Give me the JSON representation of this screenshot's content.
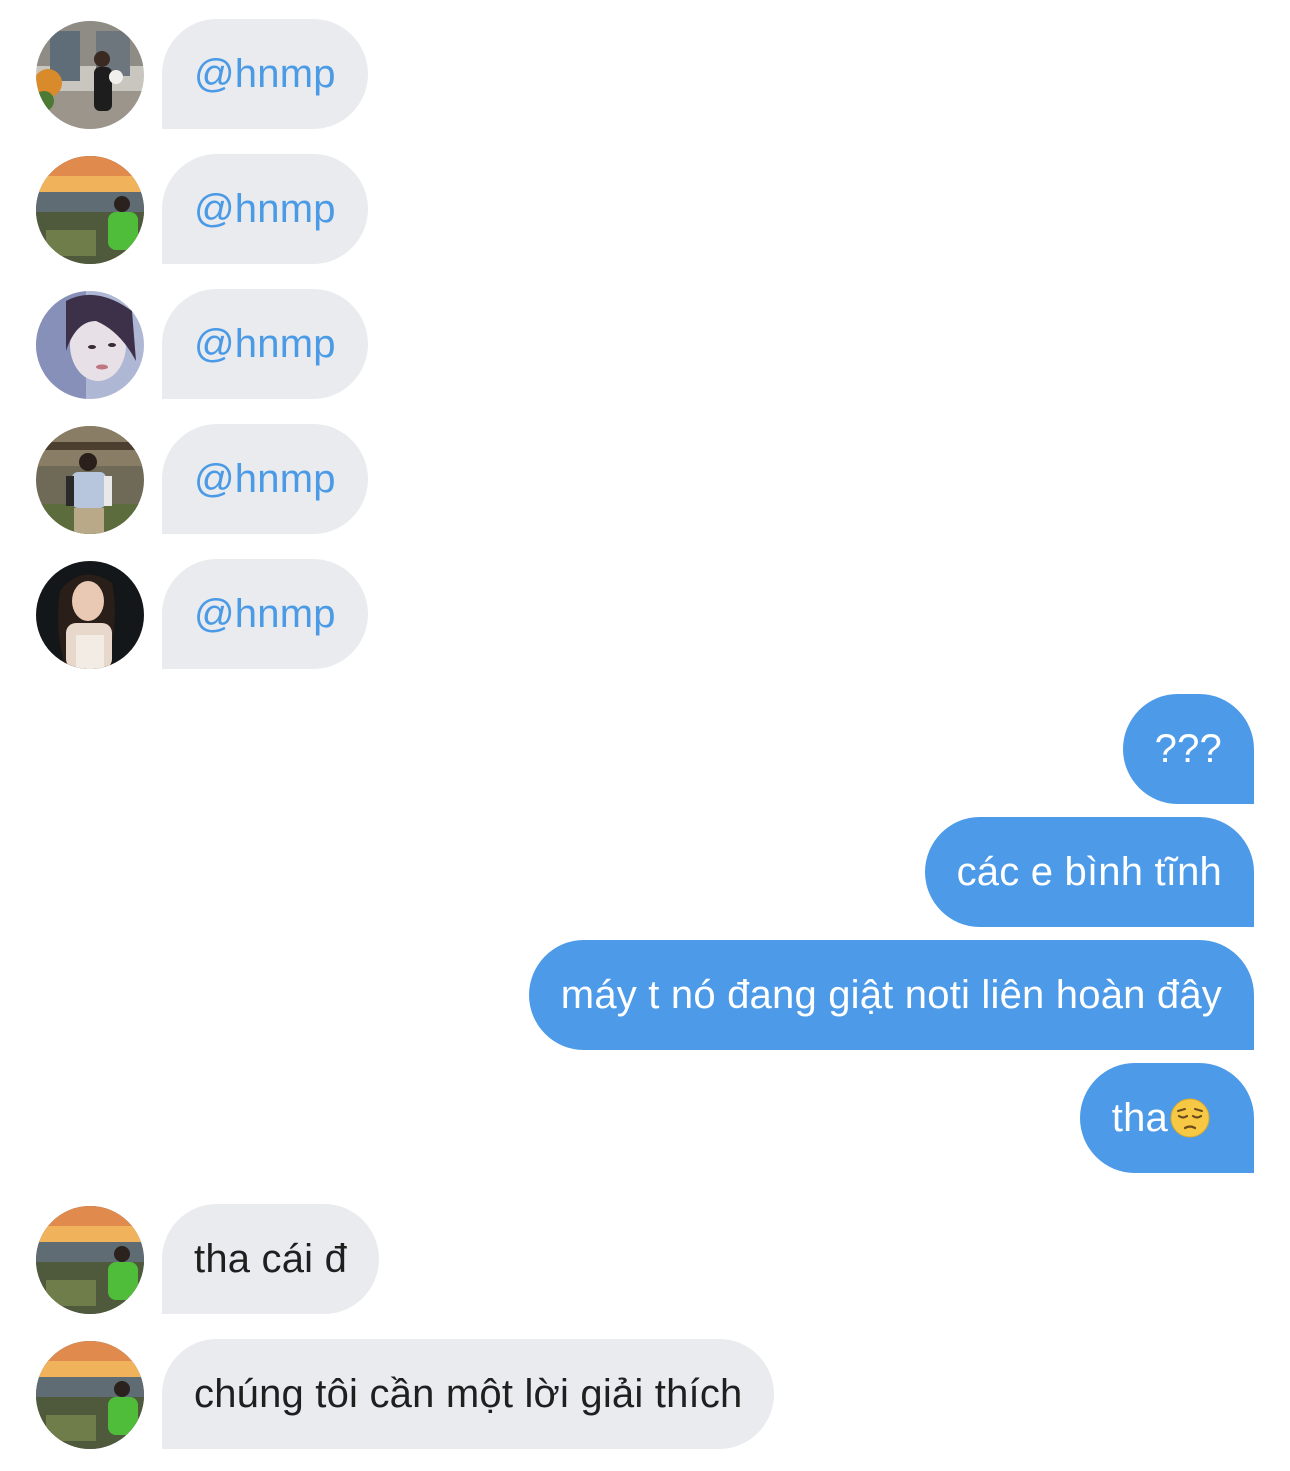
{
  "messages": [
    {
      "side": "in",
      "avatar": "avatar-photo-1",
      "text": "@hnmp",
      "mention": true
    },
    {
      "side": "in",
      "avatar": "avatar-photo-2",
      "text": "@hnmp",
      "mention": true
    },
    {
      "side": "in",
      "avatar": "avatar-photo-3",
      "text": "@hnmp",
      "mention": true
    },
    {
      "side": "in",
      "avatar": "avatar-photo-4",
      "text": "@hnmp",
      "mention": true
    },
    {
      "side": "in",
      "avatar": "avatar-photo-5",
      "text": "@hnmp",
      "mention": true
    },
    {
      "side": "out",
      "text": "???"
    },
    {
      "side": "out",
      "text": "các e bình tĩnh"
    },
    {
      "side": "out",
      "text": "máy t nó đang giật noti liên hoàn đây"
    },
    {
      "side": "out",
      "text": "tha",
      "emoji": "pensive-face-emoji"
    },
    {
      "side": "in",
      "avatar": "avatar-photo-2",
      "text": "tha cái đ"
    },
    {
      "side": "in",
      "avatar": "avatar-photo-2",
      "text": "chúng tôi cần một lời giải thích"
    }
  ],
  "colors": {
    "incoming_bubble": "#e9ebef",
    "outgoing_bubble": "#4d9be8",
    "mention_text": "#4b9ae6",
    "incoming_text": "#1f1f1f",
    "outgoing_text": "#ffffff"
  }
}
